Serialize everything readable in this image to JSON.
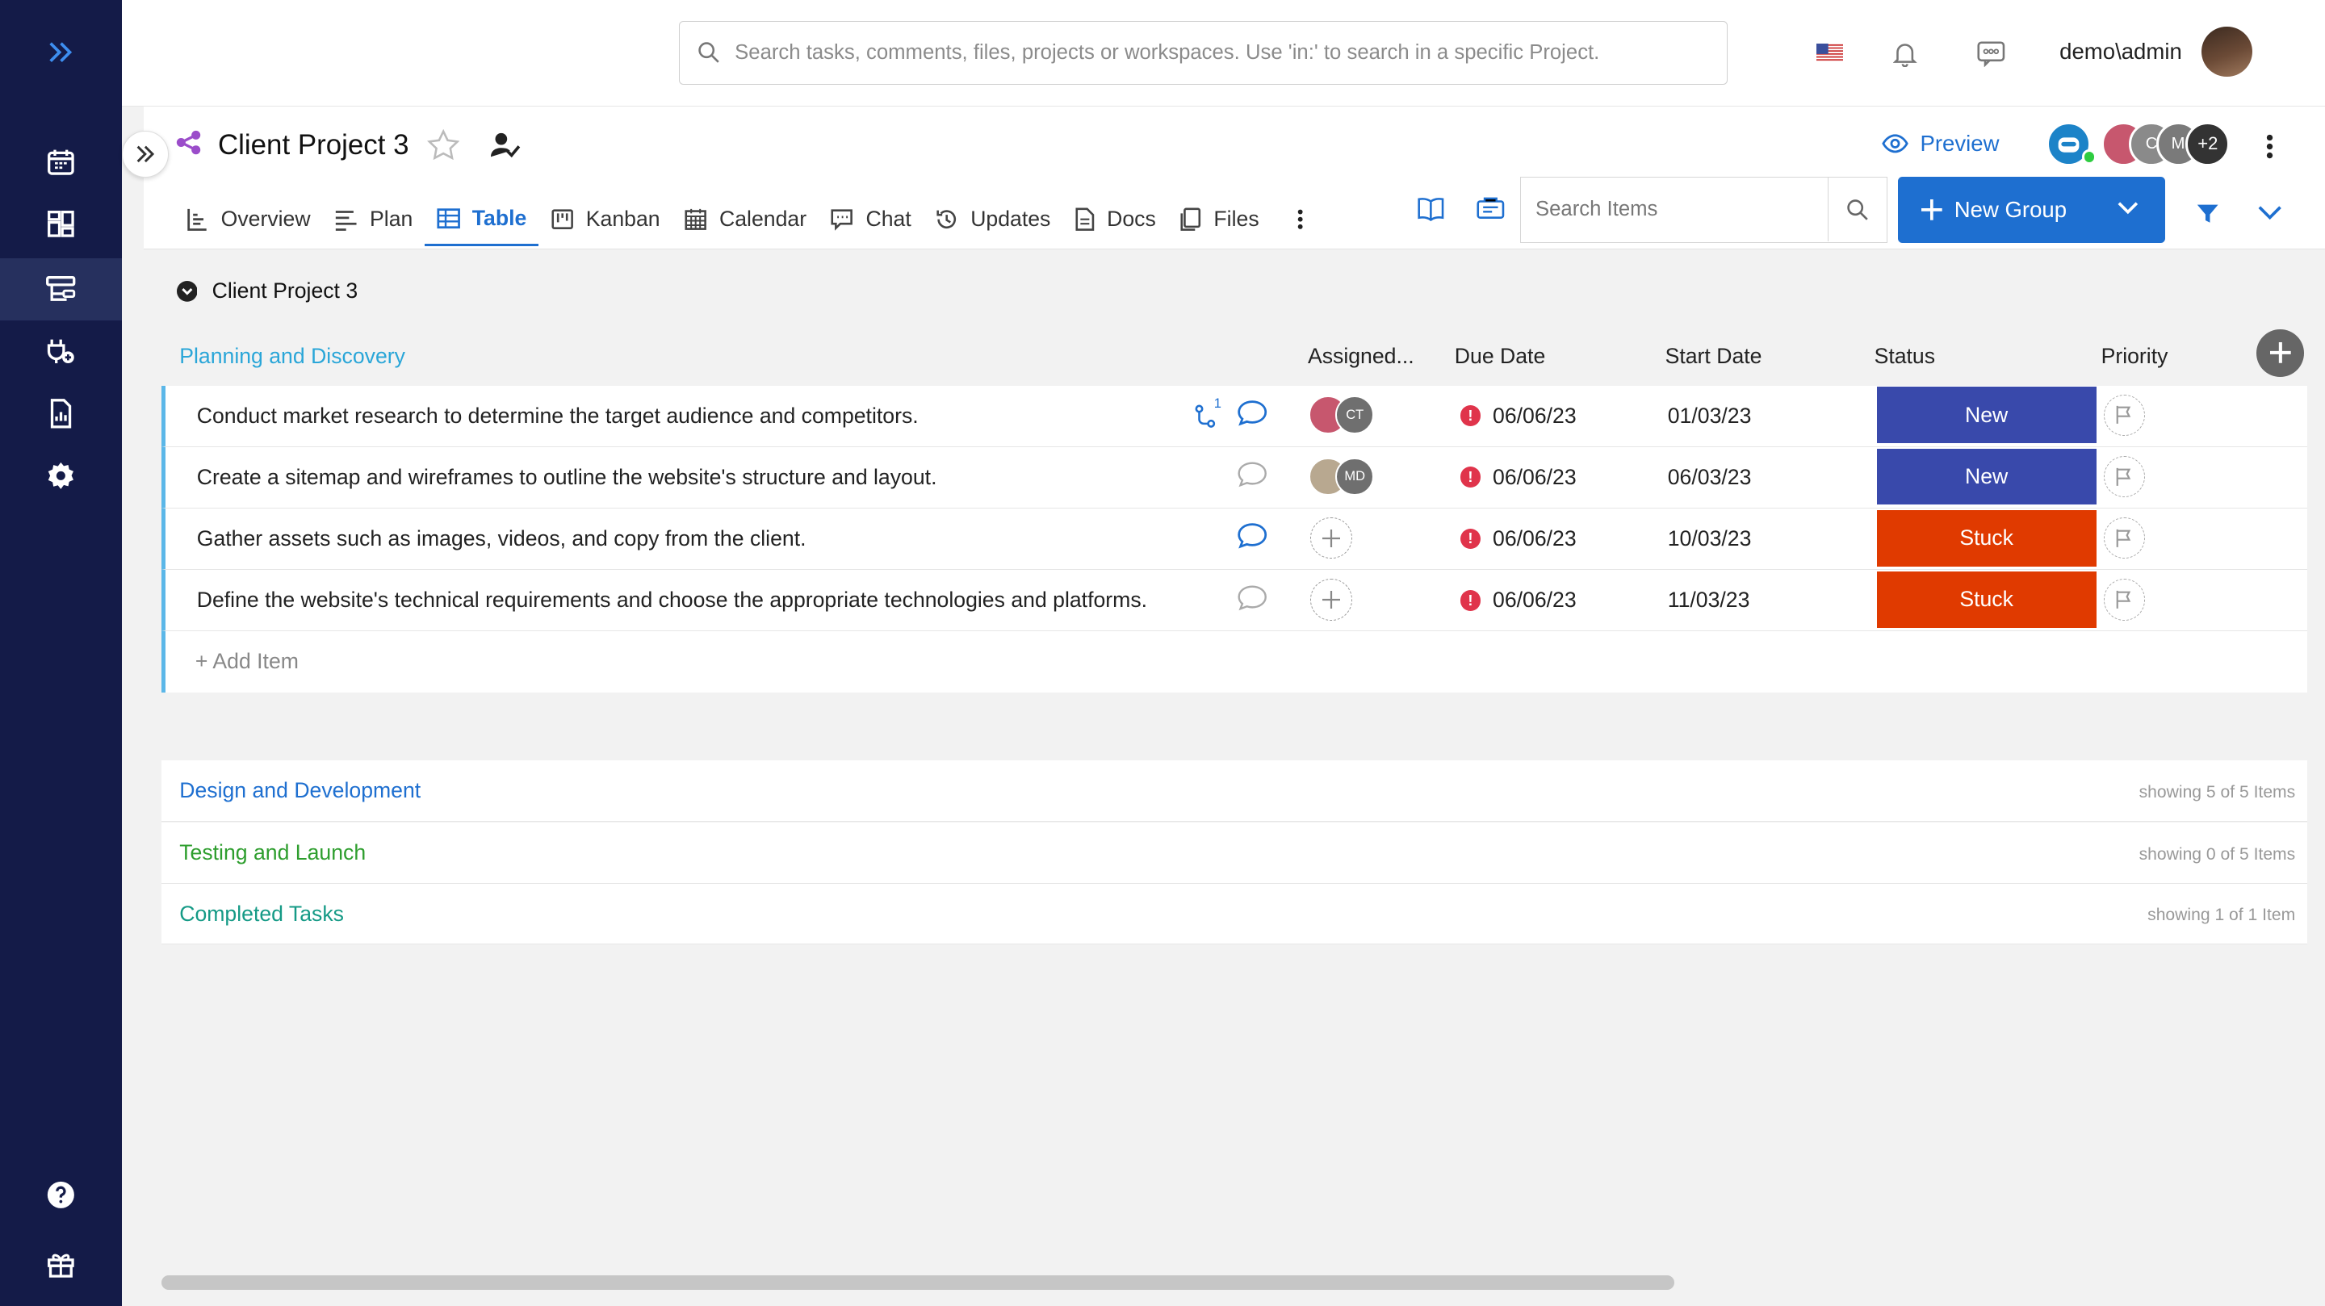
{
  "colors": {
    "rail": "#141b48",
    "accent": "#1e6fd0",
    "status_new": "#3949ab",
    "status_stuck": "#e03a00"
  },
  "topbar": {
    "search_placeholder": "Search tasks, comments, files, projects or workspaces. Use 'in:' to search in a specific Project.",
    "username": "demo\\admin"
  },
  "project": {
    "title": "Client Project 3",
    "preview_label": "Preview",
    "avatars": [
      "C",
      "M",
      "+2"
    ],
    "tabs": [
      {
        "label": "Overview",
        "icon": "overview-icon"
      },
      {
        "label": "Plan",
        "icon": "plan-icon"
      },
      {
        "label": "Table",
        "icon": "table-icon",
        "active": true
      },
      {
        "label": "Kanban",
        "icon": "kanban-icon"
      },
      {
        "label": "Calendar",
        "icon": "calendar-icon"
      },
      {
        "label": "Chat",
        "icon": "chat-icon"
      },
      {
        "label": "Updates",
        "icon": "history-icon"
      },
      {
        "label": "Docs",
        "icon": "doc-icon"
      },
      {
        "label": "Files",
        "icon": "files-icon"
      }
    ],
    "search_items_placeholder": "Search Items",
    "new_group_label": "New Group"
  },
  "board": {
    "title": "Client Project 3",
    "columns": {
      "assigned": "Assigned...",
      "due": "Due Date",
      "start": "Start Date",
      "status": "Status",
      "priority": "Priority"
    },
    "group": {
      "name": "Planning and Discovery",
      "color": "#2aa6d8",
      "rows": [
        {
          "title": "Conduct market research to determine the target audience and competitors.",
          "assignees": [
            "",
            "CT"
          ],
          "due": "06/06/23",
          "start": "01/03/23",
          "status": "New",
          "subtasks": "1",
          "has_comments": true
        },
        {
          "title": "Create a sitemap and wireframes to outline the website's structure and layout.",
          "assignees": [
            "",
            "MD"
          ],
          "due": "06/06/23",
          "start": "06/03/23",
          "status": "New",
          "subtasks": "",
          "has_comments": false
        },
        {
          "title": "Gather assets such as images, videos, and copy from the client.",
          "assignees": [],
          "due": "06/06/23",
          "start": "10/03/23",
          "status": "Stuck",
          "subtasks": "",
          "has_comments": true
        },
        {
          "title": "Define the website's technical requirements and choose the appropriate technologies and platforms.",
          "assignees": [],
          "due": "06/06/23",
          "start": "11/03/23",
          "status": "Stuck",
          "subtasks": "",
          "has_comments": false
        }
      ],
      "add_item_label": "+ Add Item"
    },
    "collapsed_groups": [
      {
        "name": "Design and Development",
        "color": "#1e6fd0",
        "count": "showing 5 of 5 Items"
      },
      {
        "name": "Testing and Launch",
        "color": "#2e9e2e",
        "count": "showing 0 of 5 Items"
      },
      {
        "name": "Completed Tasks",
        "color": "#159a86",
        "count": "showing 1 of 1 Item"
      }
    ]
  }
}
